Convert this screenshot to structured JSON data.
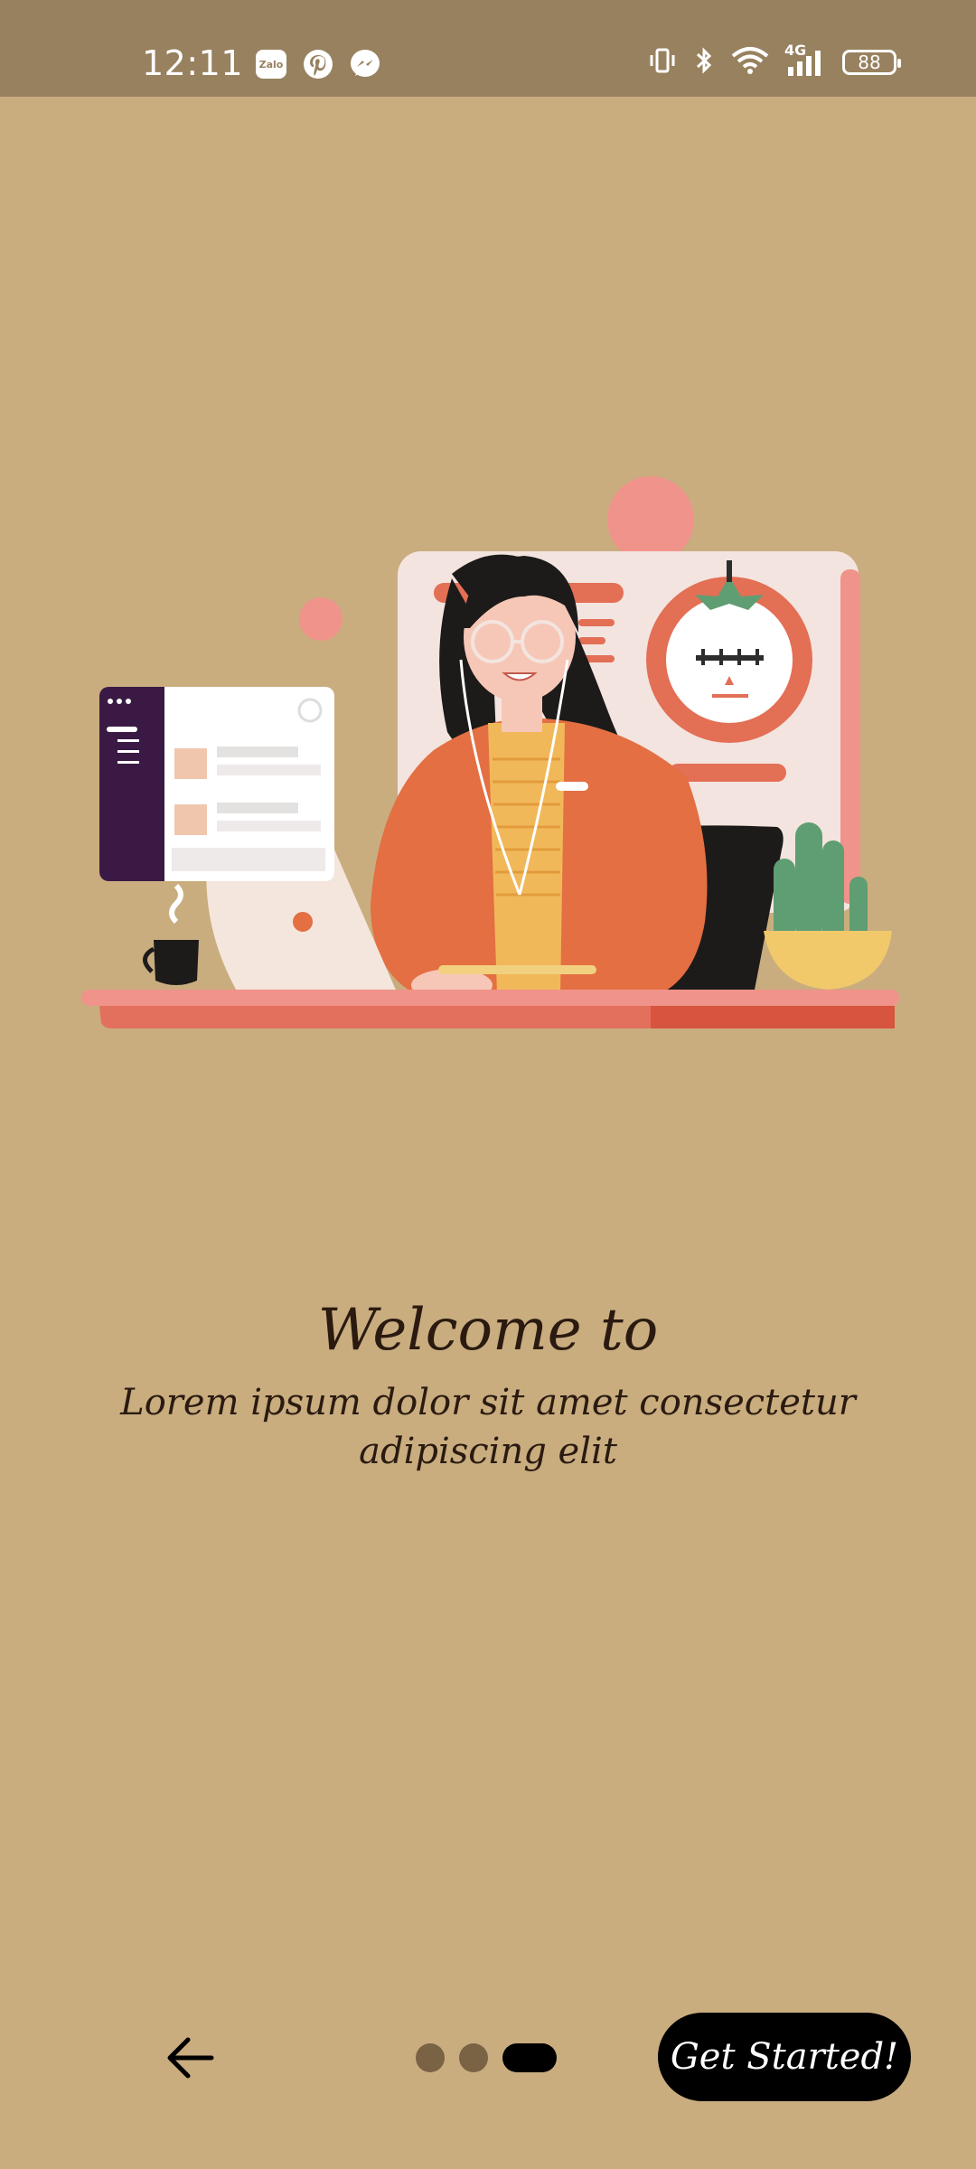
{
  "status_bar": {
    "time": "12:11",
    "left_icons": [
      "zalo-icon",
      "pinterest-icon",
      "messenger-icon"
    ],
    "zalo_label": "Zalo",
    "right_icons": [
      "vibrate-icon",
      "bluetooth-icon",
      "wifi-icon",
      "signal-4g-icon",
      "battery-icon"
    ],
    "network_label": "4G",
    "battery_level": "88"
  },
  "illustration": {
    "icon": "woman-at-desk-illustration"
  },
  "content": {
    "title": "Welcome to",
    "subtitle": "Lorem ipsum dolor sit amet consectetur adipiscing elit"
  },
  "nav": {
    "back_icon": "arrow-left-icon",
    "page_count": 3,
    "active_page": 3,
    "cta_label": "Get Started!"
  },
  "colors": {
    "background": "#c9ad7f",
    "status_bar": "#98815f",
    "button": "#000000",
    "dot_inactive": "#7a6244"
  }
}
